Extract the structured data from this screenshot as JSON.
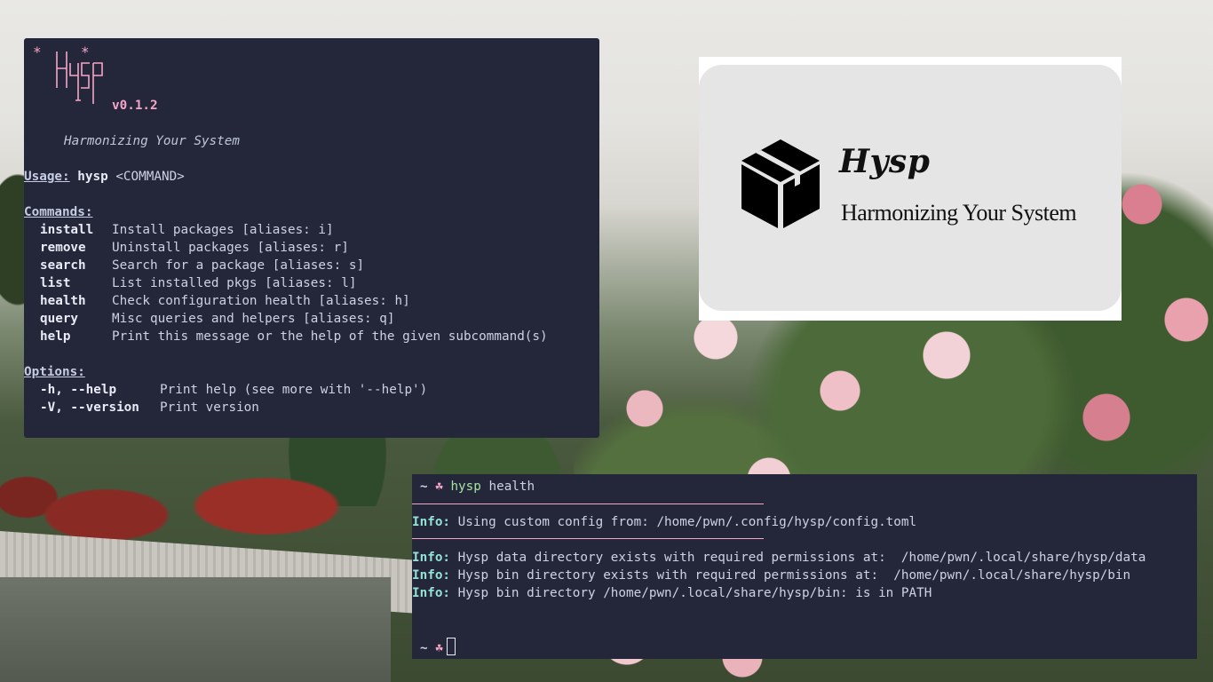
{
  "help_terminal": {
    "version": "v0.1.2",
    "tagline": "Harmonizing Your System",
    "usage": {
      "label": "Usage:",
      "program": "hysp",
      "args": "<COMMAND>"
    },
    "commands_header": "Commands:",
    "commands": [
      {
        "name": "install",
        "desc": "Install packages [aliases: i]"
      },
      {
        "name": "remove",
        "desc": "Uninstall packages [aliases: r]"
      },
      {
        "name": "search",
        "desc": "Search for a package [aliases: s]"
      },
      {
        "name": "list",
        "desc": "List installed pkgs [aliases: l]"
      },
      {
        "name": "health",
        "desc": "Check configuration health [aliases: h]"
      },
      {
        "name": "query",
        "desc": "Misc queries and helpers [aliases: q]"
      },
      {
        "name": "help",
        "desc": "Print this message or the help of the given subcommand(s)"
      }
    ],
    "options_header": "Options:",
    "options": [
      {
        "flag": "-h, --help",
        "desc": "Print help (see more with '--help')"
      },
      {
        "flag": "-V, --version",
        "desc": "Print version"
      }
    ]
  },
  "logo_card": {
    "title": "Hysp",
    "tagline": "Harmonizing Your System"
  },
  "health_terminal": {
    "prompt_symbol": "~",
    "command": "hysp",
    "subcommand": "health",
    "info_label": "Info:",
    "config_line": "Using custom config from: /home/pwn/.config/hysp/config.toml",
    "lines": [
      "Hysp data directory exists with required permissions at:  /home/pwn/.local/share/hysp/data",
      "Hysp bin directory exists with required permissions at:  /home/pwn/.local/share/hysp/bin",
      "Hysp bin directory /home/pwn/.local/share/hysp/bin: is in PATH"
    ]
  },
  "colors": {
    "terminal_bg": "#24263a",
    "accent_pink": "#f5a6c8",
    "info_teal": "#94e2d5",
    "command_green": "#a6e3a1"
  }
}
